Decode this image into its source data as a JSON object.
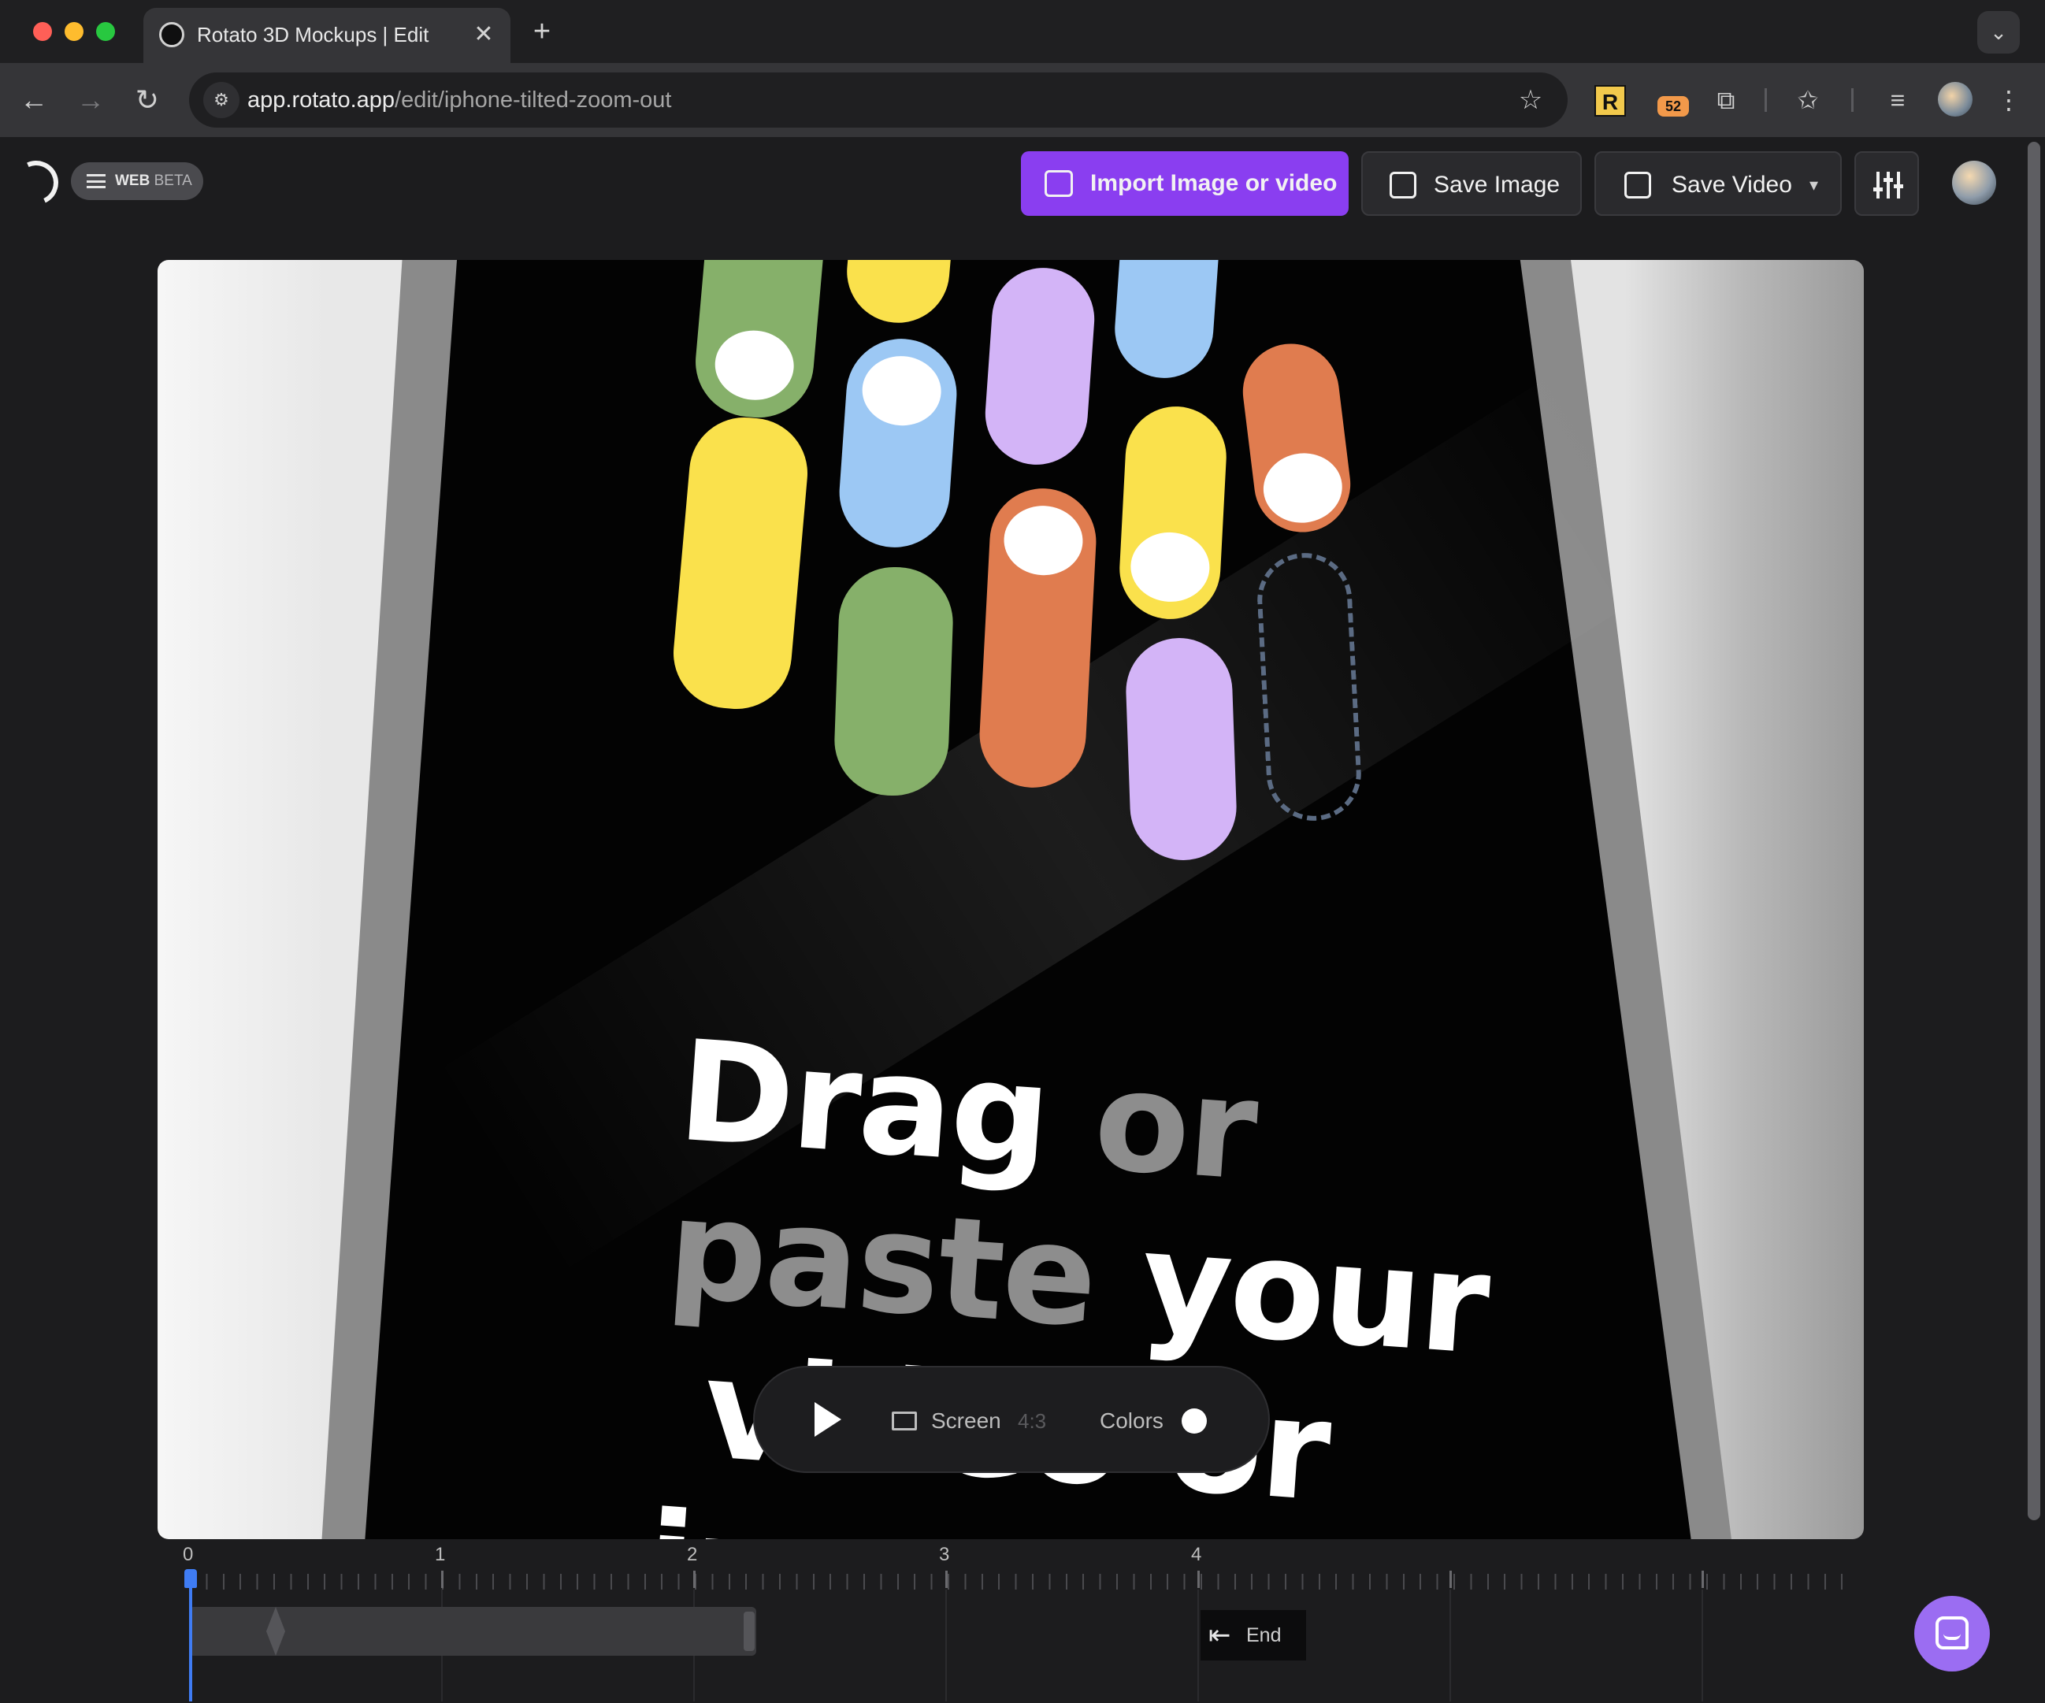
{
  "browser": {
    "tab_title": "Rotato 3D Mockups | Edit",
    "tab_close": "✕",
    "new_tab": "+",
    "tab_menu": "⌄",
    "url_host": "app.rotato.app",
    "url_path": "/edit/iphone-tilted-zoom-out",
    "extension_badge": "52",
    "extension_r_label": "R"
  },
  "app": {
    "web_label": "WEB",
    "beta_label": "BETA",
    "import_label": "Import Image or video",
    "save_image_label": "Save Image",
    "save_video_label": "Save Video",
    "accent": "#8a3ef0"
  },
  "canvas": {
    "headline_line1_a": "Drag",
    "headline_line1_b": " or",
    "headline_line2_a": "paste",
    "headline_line2_b": " your",
    "headline_line3": " video or",
    "headline_line4": "image here",
    "pill_colors": {
      "green": "#86b06a",
      "yellow": "#fae14c",
      "lilac": "#d3b4f7",
      "blue": "#9cc8f4",
      "orange": "#e07c4f"
    }
  },
  "playbar": {
    "screen_label": "Screen",
    "ratio_label": "4:3",
    "colors_label": "Colors"
  },
  "timeline": {
    "tick_labels": [
      "0",
      "1",
      "2",
      "3",
      "4"
    ],
    "end_label": "End",
    "playhead_color": "#3f7cf4"
  }
}
